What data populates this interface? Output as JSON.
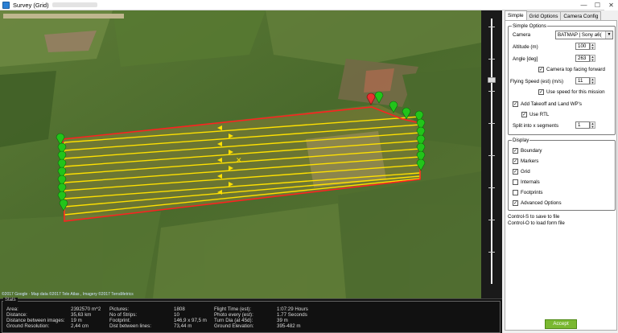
{
  "window": {
    "title": "Survey (Grid)",
    "minimize": "—",
    "maximize": "☐",
    "close": "✕"
  },
  "map": {
    "attribution": "©2017 Google · Map data ©2017 Tele Atlas , Imagery ©2017 TerraMetrics"
  },
  "stats": {
    "legend": "Stats",
    "col1": [
      {
        "label": "Area:",
        "value": "2392570 m^2"
      },
      {
        "label": "Distance:",
        "value": "35,63 km"
      },
      {
        "label": "Distance between images:",
        "value": "19 m"
      },
      {
        "label": "Ground Resolution:",
        "value": "2,44 cm"
      }
    ],
    "col2": [
      {
        "label": "Pictures:",
        "value": "1808"
      },
      {
        "label": "No of Strips:",
        "value": "10"
      },
      {
        "label": "Footprint:",
        "value": "146,9 x 97,5 m"
      },
      {
        "label": "Dist between lines:",
        "value": "73,44 m"
      }
    ],
    "col3": [
      {
        "label": "Flight Time (est):",
        "value": "1:07:29 Hours"
      },
      {
        "label": "Photo every (est):",
        "value": "1.77 Seconds"
      },
      {
        "label": "Turn Dia (at 45d):",
        "value": "39 m"
      },
      {
        "label": "Ground Elevation:",
        "value": "395-482 m"
      }
    ]
  },
  "panel": {
    "tabs": [
      "Simple",
      "Grid Options",
      "Camera Config"
    ],
    "simple_options": {
      "title": "Simple Options",
      "camera_label": "Camera",
      "camera_value": "BATMAP | Sony a6(",
      "altitude_label": "Altitude (m)",
      "altitude_value": "100",
      "angle_label": "Angle [deg]",
      "angle_value": "263",
      "camera_top_label": "Camera top facing forward",
      "flying_speed_label": "Flying Speed (est) (m/s)",
      "flying_speed_value": "11",
      "use_speed_label": "Use speed for this mission",
      "takeoff_label": "Add Takeoff and Land WP's",
      "rtl_label": "Use RTL",
      "split_label": "Split into x segments",
      "split_value": "1"
    },
    "display": {
      "title": "Display",
      "items": [
        {
          "label": "Boundary",
          "checked": true
        },
        {
          "label": "Markers",
          "checked": true
        },
        {
          "label": "Grid",
          "checked": true
        },
        {
          "label": "Internals",
          "checked": false
        },
        {
          "label": "Footprints",
          "checked": false
        },
        {
          "label": "Advanced Options",
          "checked": true
        }
      ]
    },
    "hint1": "Control-S to save to file",
    "hint2": "Control-O to load form file",
    "accept_label": "Accept"
  },
  "colors": {
    "grid_line": "#ffe000",
    "boundary": "#ff2020",
    "marker": "#22c41a",
    "accept": "#7ab830"
  }
}
